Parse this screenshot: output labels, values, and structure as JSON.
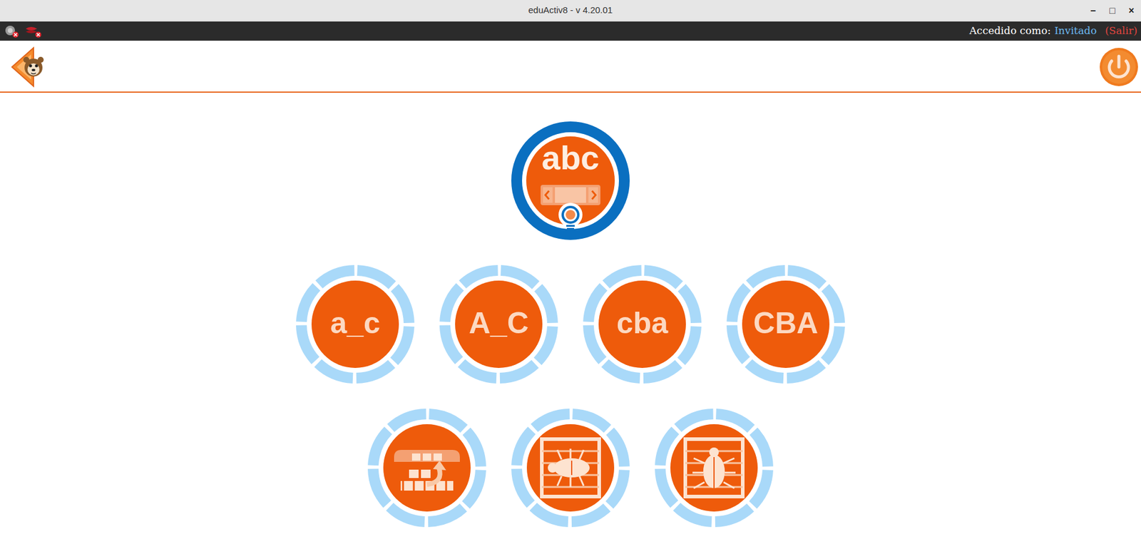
{
  "window": {
    "title": "eduActiv8 - v 4.20.01",
    "controls": [
      "–",
      "□",
      "×"
    ]
  },
  "status_bar": {
    "prefix": "Accedido como:",
    "user": "Invitado",
    "logout": "(Salir)"
  },
  "category": {
    "label": "abc"
  },
  "activities": [
    {
      "kind": "text",
      "label": "a_c"
    },
    {
      "kind": "text",
      "label": "A_C"
    },
    {
      "kind": "text",
      "label": "cba"
    },
    {
      "kind": "text",
      "label": "CBA"
    },
    {
      "kind": "icon"
    },
    {
      "kind": "icon"
    },
    {
      "kind": "icon"
    }
  ]
}
